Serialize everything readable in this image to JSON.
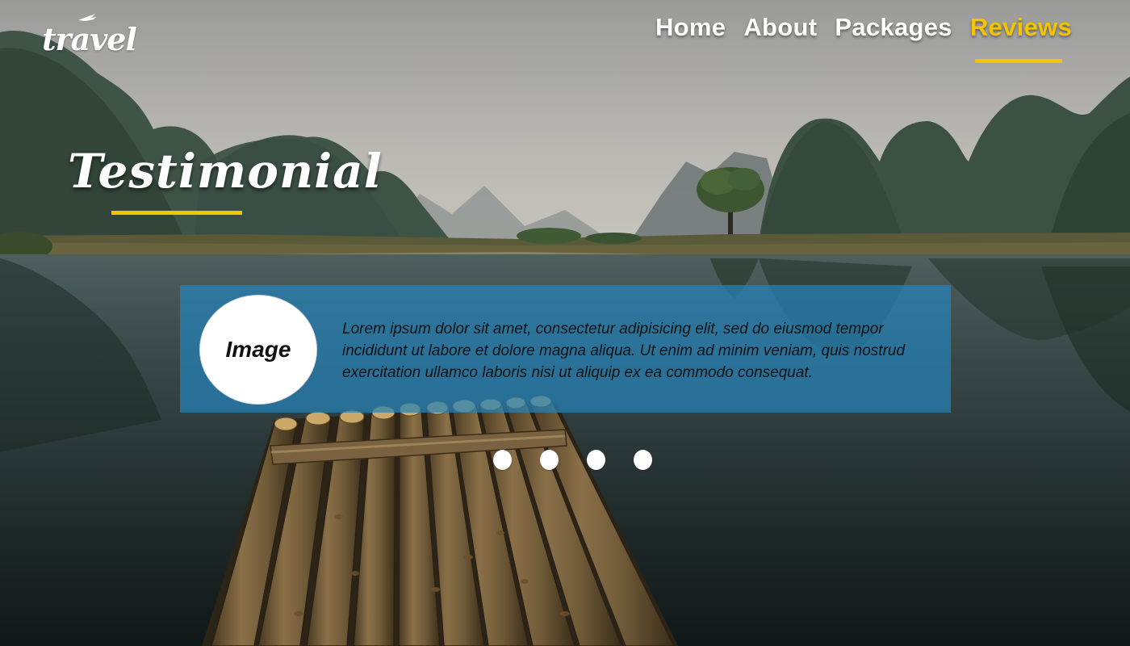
{
  "brand": {
    "logo_text": "travel"
  },
  "nav": {
    "items": [
      {
        "label": "Home"
      },
      {
        "label": "About"
      },
      {
        "label": "Packages"
      },
      {
        "label": "Reviews"
      }
    ],
    "active": "Reviews"
  },
  "page": {
    "title": "Testimonial"
  },
  "testimonial": {
    "avatar_label": "Image",
    "quote": "Lorem ipsum dolor sit amet, consectetur adipisicing elit, sed do eiusmod tempor incididunt ut labore et dolore magna aliqua. Ut enim ad minim veniam, quis nostrud exercitation ullamco laboris nisi ut aliquip ex ea commodo consequat."
  },
  "carousel": {
    "dot_count": 4
  },
  "colors": {
    "accent": "#f5c400",
    "card": "#2682b9",
    "text_light": "#ffffff",
    "text_dark": "#111111"
  },
  "background": {
    "scene": "misty karst mountains over a lake with a bamboo raft in the foreground"
  }
}
